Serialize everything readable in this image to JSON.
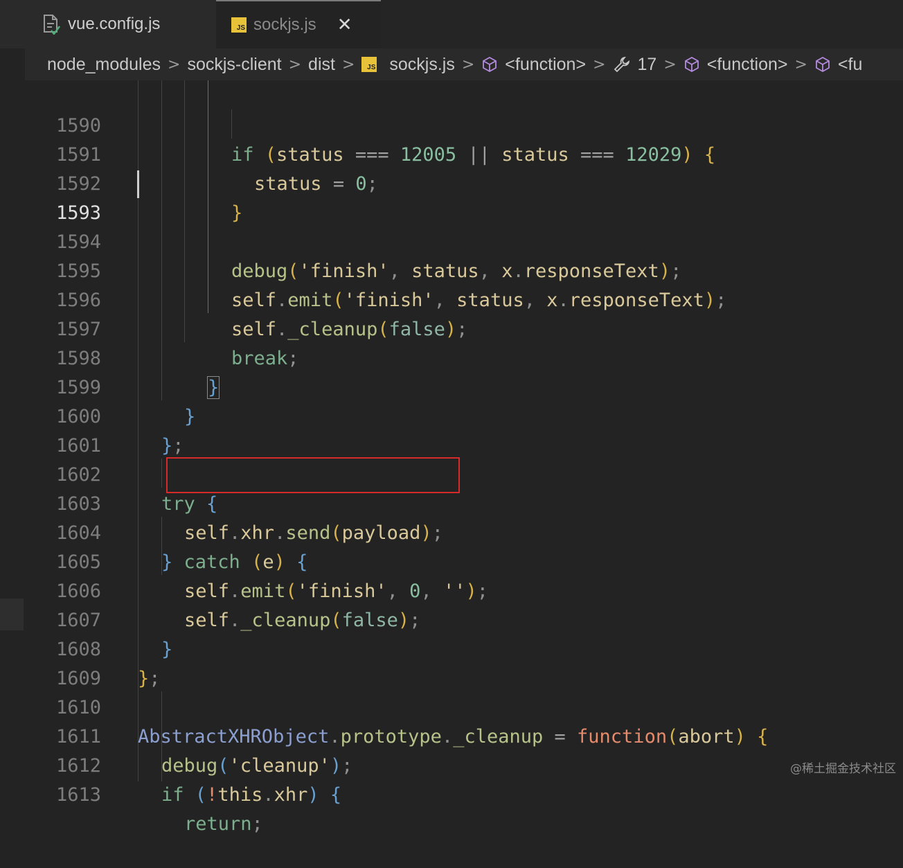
{
  "tabs": [
    {
      "label": "vue.config.js",
      "icon": "settings-file-icon",
      "active": false
    },
    {
      "label": "sockjs.js",
      "icon": "js-file-icon",
      "badge": "JS",
      "active": true,
      "close": "✕"
    }
  ],
  "breadcrumb": {
    "items": [
      {
        "label": "node_modules"
      },
      {
        "label": "sockjs-client"
      },
      {
        "label": "dist"
      },
      {
        "label": "sockjs.js",
        "icon": "js-file-icon",
        "badge": "JS"
      },
      {
        "label": "<function>",
        "icon": "cube-icon"
      },
      {
        "label": "17",
        "icon": "wrench-icon"
      },
      {
        "label": "<function>",
        "icon": "cube-icon"
      },
      {
        "label": "<fu",
        "icon": "cube-icon"
      }
    ],
    "separator": ">"
  },
  "editor": {
    "active_line": "1593",
    "lines": [
      {
        "n": "1590"
      },
      {
        "n": "1591"
      },
      {
        "n": "1592"
      },
      {
        "n": "1593"
      },
      {
        "n": "1594"
      },
      {
        "n": "1595"
      },
      {
        "n": "1596"
      },
      {
        "n": "1597"
      },
      {
        "n": "1598"
      },
      {
        "n": "1599"
      },
      {
        "n": "1600"
      },
      {
        "n": "1601"
      },
      {
        "n": "1602"
      },
      {
        "n": "1603"
      },
      {
        "n": "1604"
      },
      {
        "n": "1605"
      },
      {
        "n": "1606"
      },
      {
        "n": "1607"
      },
      {
        "n": "1608"
      },
      {
        "n": "1609"
      },
      {
        "n": "1610"
      },
      {
        "n": "1611"
      },
      {
        "n": "1612"
      },
      {
        "n": "1613"
      }
    ],
    "tokens": {
      "if": "if",
      "status": "status",
      "eq": "===",
      "n12005": "12005",
      "or": "||",
      "n12029": "12029",
      "lparen": "(",
      "rparen": ")",
      "lbrace": "{",
      "rbrace": "}",
      "assign": "=",
      "zero": "0",
      "semi": ";",
      "comma": ",",
      "dot": ".",
      "debug": "debug",
      "finish": "'finish'",
      "x": "x",
      "responseText": "responseText",
      "self": "self",
      "emit": "emit",
      "cleanup": "_cleanup",
      "false": "false",
      "break": "break",
      "try": "try",
      "xhr": "xhr",
      "send": "send",
      "payload": "payload",
      "catch": "catch",
      "e": "e",
      "empty": "''",
      "brsemi": "};",
      "AbstractXHRObject": "AbstractXHRObject",
      "prototype": "prototype",
      "function": "function",
      "abort": "abort",
      "cleanupstr": "'cleanup'",
      "bang": "!",
      "this": "this",
      "return": "return"
    }
  },
  "highlight": {
    "color": "#d72a2a",
    "target_line": "1603"
  },
  "watermark": "@稀土掘金技术社区"
}
